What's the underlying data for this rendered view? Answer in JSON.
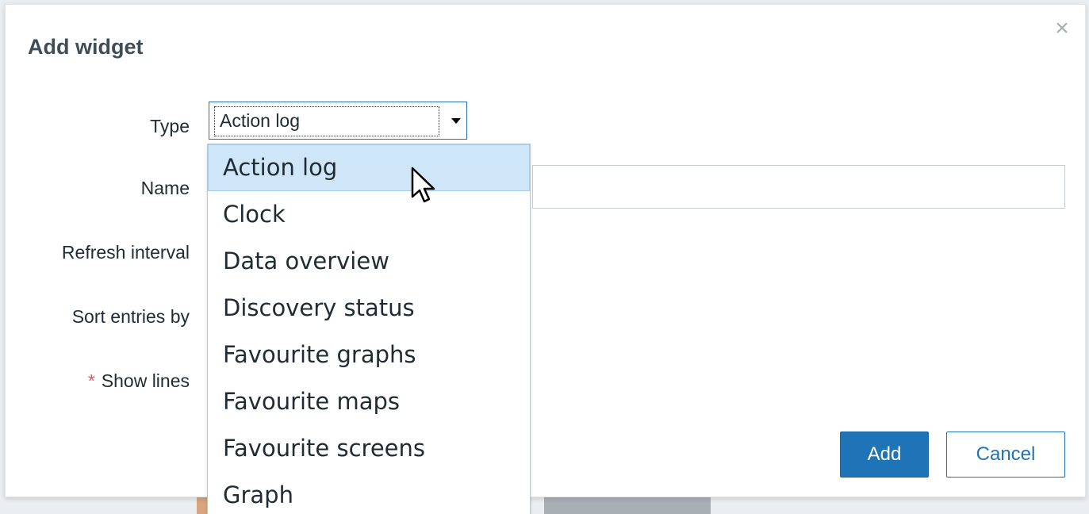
{
  "dialog": {
    "title": "Add widget",
    "close_glyph": "×",
    "close_icon": "close-icon"
  },
  "form": {
    "type_label": "Type",
    "type_value": "Action log",
    "name_label": "Name",
    "name_value": "",
    "refresh_label": "Refresh interval",
    "sort_label": "Sort entries by",
    "show_lines_label": "Show lines",
    "required_marker": "*"
  },
  "dropdown": {
    "options": [
      "Action log",
      "Clock",
      "Data overview",
      "Discovery status",
      "Favourite graphs",
      "Favourite maps",
      "Favourite screens",
      "Graph"
    ],
    "selected_index": 0
  },
  "buttons": {
    "add": "Add",
    "cancel": "Cancel"
  },
  "colors": {
    "primary": "#1f73b7",
    "title": "#3e4e58",
    "highlight": "#cfe6f8",
    "required": "#e45959"
  }
}
